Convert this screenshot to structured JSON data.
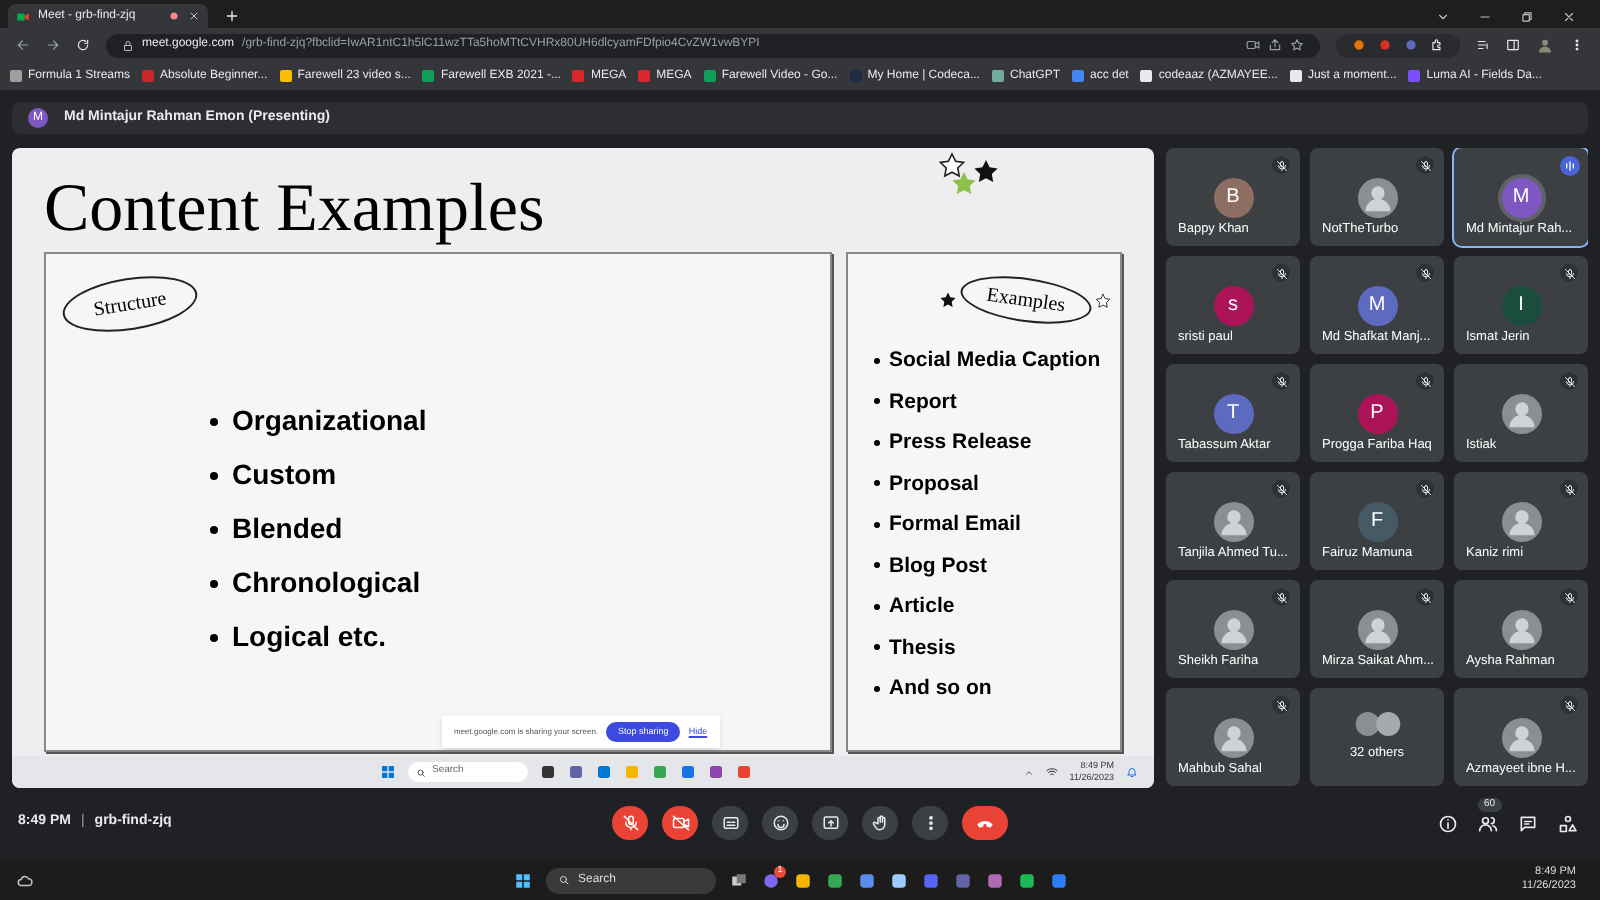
{
  "browser": {
    "tab_title": "Meet - grb-find-zjq",
    "url_host": "meet.google.com",
    "url_path": "/grb-find-zjq?fbclid=IwAR1ntC1h5lC11wzTTa5hoMTtCVHRx80UH6dlcyamFDfpio4CvZW1vwBYPI",
    "bookmarks": [
      {
        "label": "Formula 1 Streams",
        "color": "#9e9e9e"
      },
      {
        "label": "Absolute Beginner...",
        "color": "#c62828"
      },
      {
        "label": "Farewell 23 video s...",
        "color": "#fbbc04"
      },
      {
        "label": "Farewell EXB 2021 -...",
        "color": "#0f9d58"
      },
      {
        "label": "MEGA",
        "color": "#d9272e"
      },
      {
        "label": "MEGA",
        "color": "#d9272e"
      },
      {
        "label": "Farewell Video - Go...",
        "color": "#0f9d58"
      },
      {
        "label": "My Home | Codeca...",
        "color": "#1f2a44"
      },
      {
        "label": "ChatGPT",
        "color": "#74aa9c"
      },
      {
        "label": "acc det",
        "color": "#4285f4"
      },
      {
        "label": "codeaaz (AZMAYEE...",
        "color": "#e8eaed"
      },
      {
        "label": "Just a moment...",
        "color": "#e8eaed"
      },
      {
        "label": "Luma AI - Fields Da...",
        "color": "#7c4dff"
      }
    ]
  },
  "presenter": {
    "initial": "M",
    "name": "Md Mintajur Rahman Emon (Presenting)"
  },
  "slide": {
    "title": "Content Examples",
    "structure_label": "Structure",
    "structure_items": [
      "Organizational",
      "Custom",
      "Blended",
      "Chronological",
      "Logical etc."
    ],
    "examples_label": "Examples",
    "examples_items": [
      "Social Media Caption",
      "Report",
      "Press Release",
      "Proposal",
      "Formal Email",
      "Blog Post",
      "Article",
      "Thesis",
      "And so on"
    ],
    "share_notice": "meet.google.com is sharing your screen.",
    "stop_sharing": "Stop sharing",
    "hide": "Hide",
    "taskbar_search": "Search",
    "taskbar_time": "8:49 PM",
    "taskbar_date": "11/26/2023"
  },
  "participants": [
    {
      "name": "Bappy Khan",
      "kind": "initial",
      "initial": "B",
      "color": "#8d6e63",
      "muted": true,
      "speaking": false
    },
    {
      "name": "NotTheTurbo",
      "kind": "photo",
      "muted": true,
      "speaking": false
    },
    {
      "name": "Md Mintajur Rah...",
      "kind": "initial",
      "initial": "M",
      "color": "#7e57c2",
      "muted": false,
      "speaking": true
    },
    {
      "name": "sristi paul",
      "kind": "initial",
      "initial": "s",
      "color": "#ad1457",
      "muted": true,
      "speaking": false
    },
    {
      "name": "Md Shafkat Manj...",
      "kind": "initial",
      "initial": "M",
      "color": "#5c6bc0",
      "muted": true,
      "speaking": false
    },
    {
      "name": "Ismat Jerin",
      "kind": "initial",
      "initial": "I",
      "color": "#1b4d3e",
      "muted": true,
      "speaking": false
    },
    {
      "name": "Tabassum Aktar",
      "kind": "initial",
      "initial": "T",
      "color": "#5c6bc0",
      "muted": true,
      "speaking": false
    },
    {
      "name": "Progga Fariba Haq",
      "kind": "initial",
      "initial": "P",
      "color": "#ad1457",
      "muted": true,
      "speaking": false
    },
    {
      "name": "Istiak",
      "kind": "photo",
      "muted": true,
      "speaking": false
    },
    {
      "name": "Tanjila Ahmed Tu...",
      "kind": "photo",
      "muted": true,
      "speaking": false
    },
    {
      "name": "Fairuz Mamuna",
      "kind": "initial",
      "initial": "F",
      "color": "#455a64",
      "muted": true,
      "speaking": false
    },
    {
      "name": "Kaniz rimi",
      "kind": "photo",
      "muted": true,
      "speaking": false
    },
    {
      "name": "Sheikh Fariha",
      "kind": "photo",
      "muted": true,
      "speaking": false
    },
    {
      "name": "Mirza Saikat Ahm...",
      "kind": "photo",
      "muted": true,
      "speaking": false
    },
    {
      "name": "Aysha Rahman",
      "kind": "photo",
      "muted": true,
      "speaking": false
    },
    {
      "name": "Mahbub Sahal",
      "kind": "photo",
      "muted": true,
      "speaking": false
    },
    {
      "name": "32 others",
      "kind": "group",
      "muted": false,
      "speaking": false
    },
    {
      "name": "Azmayeet ibne H...",
      "kind": "photo",
      "muted": true,
      "speaking": false
    }
  ],
  "call_bar": {
    "time": "8:49 PM",
    "separator": "|",
    "meeting_code": "grb-find-zjq",
    "mic_on": false,
    "camera_on": false,
    "people_count": "60"
  },
  "taskbar": {
    "search": "Search",
    "chat_badge": "1",
    "time": "8:49 PM",
    "date": "11/26/2023"
  }
}
